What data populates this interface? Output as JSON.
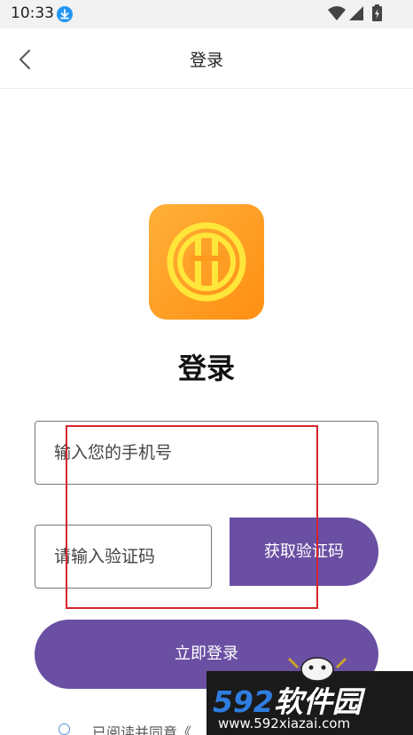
{
  "status_bar": {
    "time": "10:33",
    "icons": [
      "download-icon",
      "wifi-icon",
      "signal-icon",
      "battery-icon"
    ]
  },
  "nav": {
    "title": "登录",
    "back_icon": "chevron-left-icon"
  },
  "logo": {
    "icon": "app-logo-icon",
    "colors": [
      "#ffb03a",
      "#ff8f12",
      "#ffe63a"
    ]
  },
  "page_title": "登录",
  "form": {
    "phone_placeholder": "输入您的手机号",
    "phone_value": "",
    "code_placeholder": "请输入验证码",
    "code_value": "",
    "get_code_label": "获取验证码",
    "login_label": "立即登录"
  },
  "agreement": {
    "checked": false,
    "text": "已阅读并同意《"
  },
  "watermark": {
    "brand_num": "592",
    "brand_cn": "软件园",
    "url": "www.592xiazai.com"
  },
  "colors": {
    "accent": "#6a4fa3",
    "highlight": "#d6242b",
    "text": "#222222"
  }
}
